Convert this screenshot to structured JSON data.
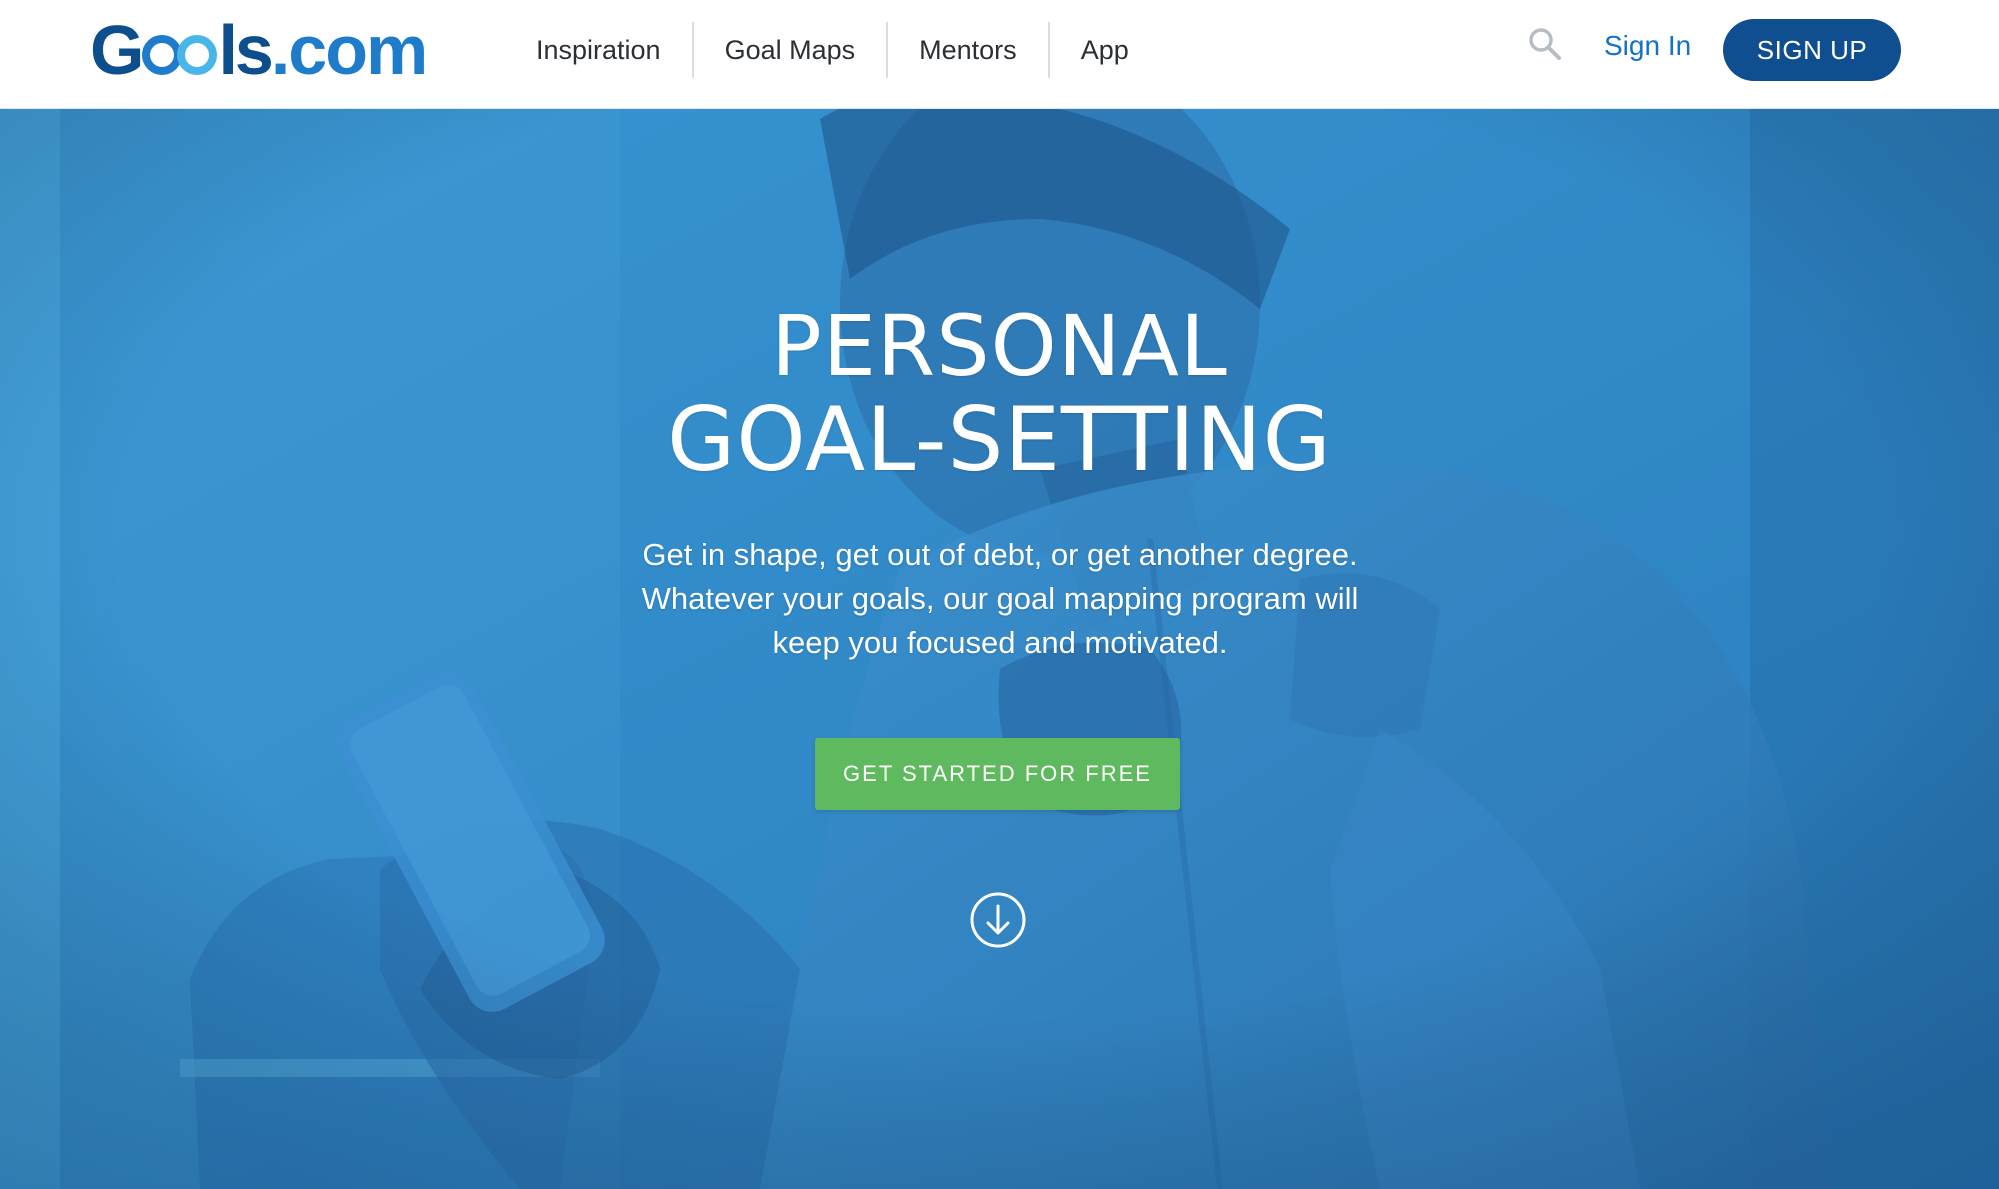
{
  "brand": {
    "logo_g": "G",
    "logo_rest": "ls",
    "logo_dotcom": ".com",
    "logo_full": "Goals.com"
  },
  "nav": {
    "items": [
      {
        "label": "Inspiration"
      },
      {
        "label": "Goal Maps"
      },
      {
        "label": "Mentors"
      },
      {
        "label": "App"
      }
    ]
  },
  "header": {
    "search_icon": "search-icon",
    "signin_label": "Sign In",
    "signup_label": "SIGN UP"
  },
  "hero": {
    "title_line1": "PERSONAL",
    "title_line2": "GOAL-SETTING",
    "subtitle_line1": "Get in shape, get out of debt, or get another degree.",
    "subtitle_line2": "Whatever your goals, our goal mapping program will",
    "subtitle_line3": "keep you focused and motivated.",
    "cta_label": "GET STARTED FOR FREE",
    "scroll_icon": "arrow-down-circle-icon"
  },
  "colors": {
    "brand_dark": "#0f4e8f",
    "brand_blue": "#1372c4",
    "brand_light": "#49b6ea",
    "cta_green": "#5fba5f",
    "hero_overlay": "#2a7ab9"
  }
}
